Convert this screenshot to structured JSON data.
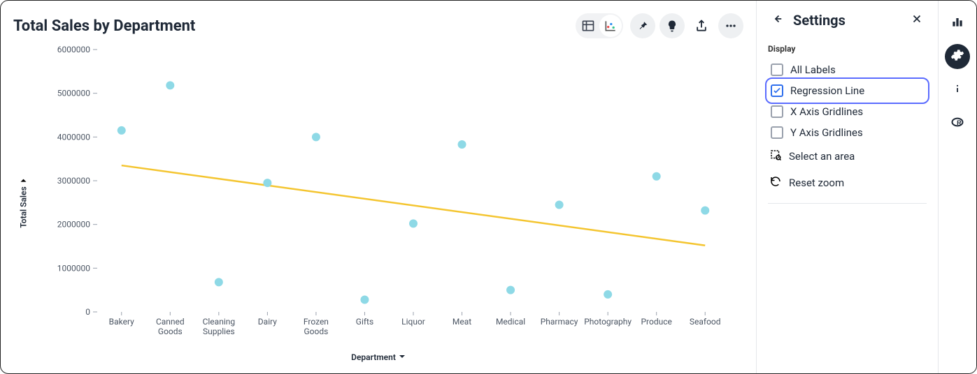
{
  "header": {
    "title": "Total Sales by Department"
  },
  "toolbar": {
    "table_view_tooltip": "Table",
    "chart_view_tooltip": "Chart",
    "pin_tooltip": "Pin",
    "insight_tooltip": "Insight",
    "share_tooltip": "Share",
    "more_tooltip": "More"
  },
  "settings": {
    "panel_title": "Settings",
    "display_label": "Display",
    "checks": [
      {
        "id": "all_labels",
        "label": "All Labels",
        "checked": false,
        "focused": false
      },
      {
        "id": "regression_line",
        "label": "Regression Line",
        "checked": true,
        "focused": true
      },
      {
        "id": "x_gridlines",
        "label": "X Axis Gridlines",
        "checked": false,
        "focused": false
      },
      {
        "id": "y_gridlines",
        "label": "Y Axis Gridlines",
        "checked": false,
        "focused": false
      }
    ],
    "select_area_label": "Select an area",
    "reset_zoom_label": "Reset zoom"
  },
  "rail": {
    "chart_tooltip": "Chart",
    "settings_tooltip": "Settings",
    "info_tooltip": "Info",
    "r_tooltip": "R"
  },
  "chart_data": {
    "type": "scatter",
    "title": "Total Sales by Department",
    "xlabel": "Department",
    "ylabel": "Total Sales",
    "xtype": "category",
    "categories": [
      "Bakery",
      "Canned Goods",
      "Cleaning Supplies",
      "Dairy",
      "Frozen Goods",
      "Gifts",
      "Liquor",
      "Meat",
      "Medical",
      "Pharmacy",
      "Photography",
      "Produce",
      "Seafood"
    ],
    "values": [
      4150000,
      5180000,
      680000,
      2950000,
      4000000,
      280000,
      2020000,
      3830000,
      500000,
      2450000,
      400000,
      3100000,
      2320000
    ],
    "ylim": [
      0,
      6000000
    ],
    "yticks": [
      0,
      1000000,
      2000000,
      3000000,
      4000000,
      5000000,
      6000000
    ],
    "grid": false,
    "regression_line": {
      "visible": true,
      "y_start": 3350000,
      "y_end": 1520000,
      "color": "#f4c530"
    },
    "point_color": "#8ed9e6",
    "legend": false
  }
}
